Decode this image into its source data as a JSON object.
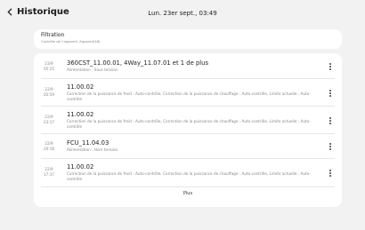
{
  "header": {
    "back_label": "Historique",
    "datetime": "Lun. 23er sept., 03:49"
  },
  "filter": {
    "title": "Filtration",
    "subtitle": "Contrôle de l'appareil, Appareil(48)"
  },
  "entries": [
    {
      "date": "23/9",
      "time": "05:25",
      "title": "360CST_11.00.01, 4Way_11.07.01 et 1 de plus",
      "description": "Alimentation : Sous tension"
    },
    {
      "date": "22/9",
      "time": "02:59",
      "title": "11.00.02",
      "description": "Correction de la puissance de froid : Auto-contrôle, Correction de la puissance de chauffage : Auto-contrôle, Limite actuelle : Auto-contrôle"
    },
    {
      "date": "22/9",
      "time": "23:17",
      "title": "11.00.02",
      "description": "Correction de la puissance de froid : Auto-contrôle, Correction de la puissance de chauffage : Auto-contrôle, Limite actuelle : Auto-contrôle"
    },
    {
      "date": "22/9",
      "time": "20:18",
      "title": "FCU_11.04.03",
      "description": "Alimentation : Hors tension"
    },
    {
      "date": "22/9",
      "time": "17:37",
      "title": "11.00.02",
      "description": "Correction de la puissance de froid : Auto-contrôle, Correction de la puissance de chauffage : Auto-contrôle, Limite actuelle : Auto-contrôle"
    }
  ],
  "more_label": "Plus"
}
